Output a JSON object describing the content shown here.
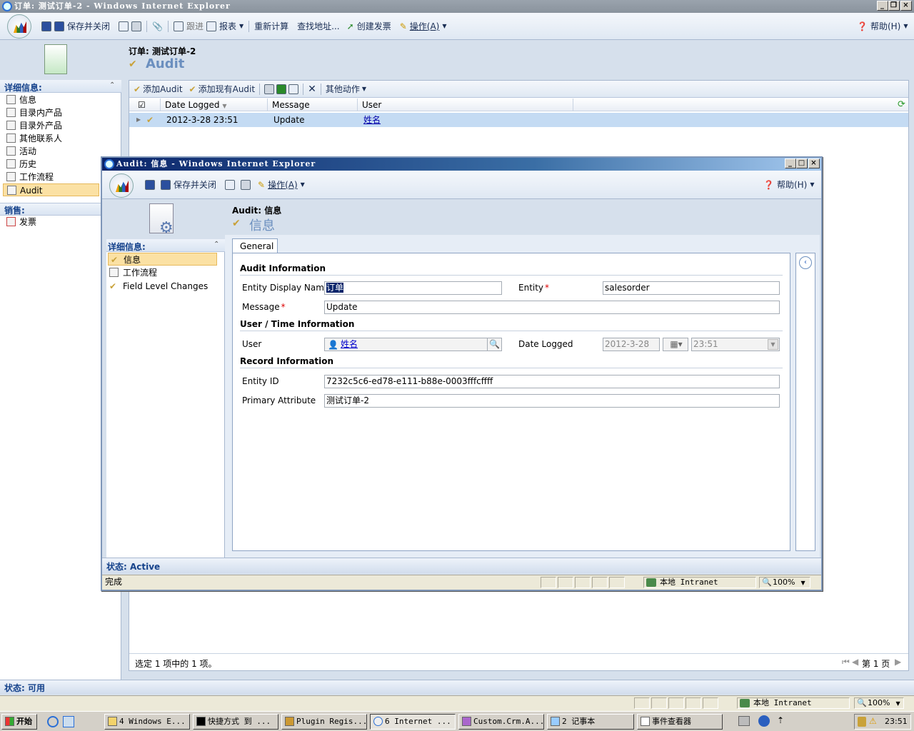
{
  "main_window": {
    "title": "订单: 测试订单-2 - Windows Internet Explorer",
    "toolbar": {
      "save_close": "保存并关闭",
      "follow_up": "跟进",
      "reports": "报表",
      "recalculate": "重新计算",
      "lookup_address": "查找地址...",
      "create_invoice": "创建发票",
      "actions": "操作(A)",
      "help": "帮助(H)"
    },
    "record_header": "订单: 测试订单-2",
    "record_subtitle": "Audit",
    "nav": {
      "details_header": "详细信息:",
      "items": [
        {
          "label": "信息"
        },
        {
          "label": "目录内产品"
        },
        {
          "label": "目录外产品"
        },
        {
          "label": "其他联系人"
        },
        {
          "label": "活动"
        },
        {
          "label": "历史"
        },
        {
          "label": "工作流程"
        },
        {
          "label": "Audit"
        }
      ],
      "sales_header": "销售:",
      "sales_items": [
        {
          "label": "发票"
        }
      ]
    },
    "grid_toolbar": {
      "add_audit": "添加Audit",
      "add_existing": "添加现有Audit",
      "more_actions": "其他动作"
    },
    "grid": {
      "columns": [
        "Date Logged",
        "Message",
        "User"
      ],
      "rows": [
        {
          "date": "2012-3-28 23:51",
          "message": "Update",
          "user": "姓名"
        }
      ],
      "footer": "选定 1 项中的 1 项。",
      "pager": "第 1 页"
    },
    "status": "状态: 可用",
    "ie_status": {
      "zone": "本地 Intranet",
      "zoom": "100%"
    }
  },
  "popup_window": {
    "title": "Audit: 信息 - Windows Internet Explorer",
    "toolbar": {
      "save_close": "保存并关闭",
      "actions": "操作(A)",
      "help": "帮助(H)"
    },
    "record_header": "Audit: 信息",
    "record_subtitle": "信息",
    "nav": {
      "details_header": "详细信息:",
      "items": [
        {
          "label": "信息"
        },
        {
          "label": "工作流程"
        },
        {
          "label": "Field Level Changes"
        }
      ]
    },
    "tab": "General",
    "sections": {
      "audit_info": "Audit Information",
      "user_time": "User / Time Information",
      "record_info": "Record Information"
    },
    "fields": {
      "entity_display_name_label": "Entity Display Name",
      "entity_display_name": "订单",
      "entity_label": "Entity",
      "entity": "salesorder",
      "message_label": "Message",
      "message": "Update",
      "user_label": "User",
      "user": "姓名",
      "date_logged_label": "Date Logged",
      "date": "2012-3-28",
      "time": "23:51",
      "entity_id_label": "Entity ID",
      "entity_id": "7232c5c6-ed78-e111-b88e-0003fffcffff",
      "primary_attribute_label": "Primary Attribute",
      "primary_attribute": "测试订单-2"
    },
    "status": "状态: Active",
    "ie_status": {
      "done": "完成",
      "zone": "本地 Intranet",
      "zoom": "100%"
    }
  },
  "taskbar": {
    "start": "开始",
    "buttons": [
      "4 Windows E...",
      "快捷方式 到 ...",
      "Plugin Regis...",
      "6 Internet ...",
      "Custom.Crm.A...",
      "2 记事本",
      "事件查看器"
    ],
    "clock": "23:51"
  },
  "colors": {
    "accent": "#15428b",
    "selected_row": "#c4dbf3",
    "nav_selected": "#fbe1a4"
  }
}
